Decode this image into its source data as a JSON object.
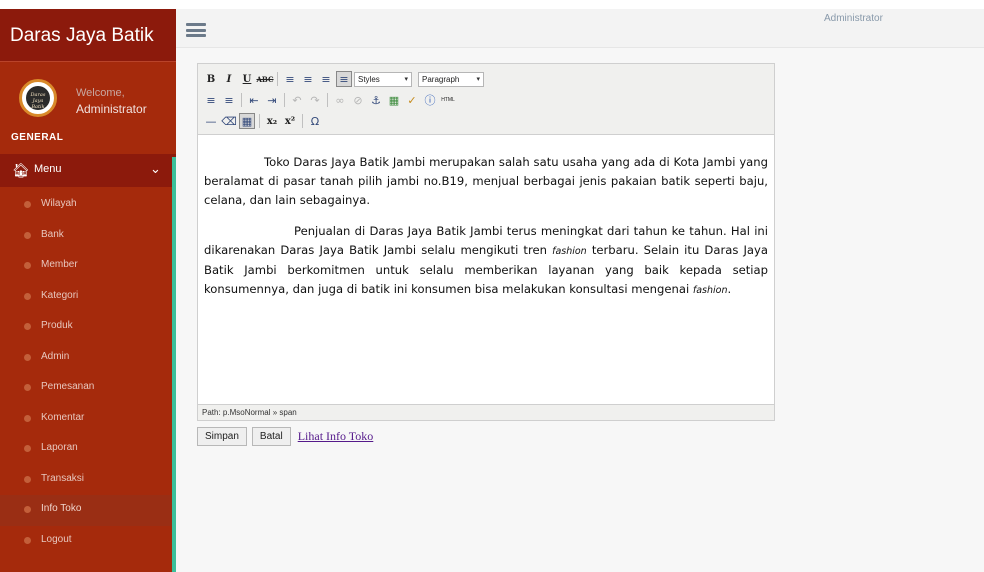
{
  "app": {
    "title": "Daras Jaya Batik"
  },
  "header": {
    "user": "Administrator"
  },
  "profile": {
    "avatar_text": "Daras Jaya Batik",
    "welcome": "Welcome,",
    "name": "Administrator",
    "section": "GENERAL"
  },
  "sidebar": {
    "menu_label": "Menu",
    "items": [
      {
        "label": "Wilayah"
      },
      {
        "label": "Bank"
      },
      {
        "label": "Member"
      },
      {
        "label": "Kategori"
      },
      {
        "label": "Produk"
      },
      {
        "label": "Admin"
      },
      {
        "label": "Pemesanan"
      },
      {
        "label": "Komentar"
      },
      {
        "label": "Laporan"
      },
      {
        "label": "Transaksi"
      },
      {
        "label": "Info Toko",
        "active": true
      },
      {
        "label": "Logout"
      }
    ]
  },
  "editor": {
    "styles_select": "Styles",
    "format_select": "Paragraph",
    "html_button": "HTML",
    "paragraph1": "Toko Daras Jaya Batik Jambi merupakan salah satu usaha yang ada di Kota Jambi yang beralamat di pasar tanah pilih jambi no.B19, menjual berbagai jenis pakaian batik seperti baju, celana, dan lain sebagainya.",
    "paragraph2_a": "Penjualan di Daras Jaya Batik Jambi terus meningkat dari tahun ke tahun. Hal ini dikarenakan Daras Jaya Batik Jambi selalu mengikuti tren ",
    "paragraph2_em1": "fashion",
    "paragraph2_b": " terbaru. Selain itu Daras Jaya Batik Jambi berkomitmen untuk selalu memberikan layanan yang baik kepada setiap konsumennya, dan juga di batik ini konsumen bisa melakukan konsultasi mengenai ",
    "paragraph2_em2": "fashion",
    "paragraph2_c": ".",
    "path": "Path: p.MsoNormal » span"
  },
  "actions": {
    "save": "Simpan",
    "cancel": "Batal",
    "link": "Lihat Info Toko"
  }
}
